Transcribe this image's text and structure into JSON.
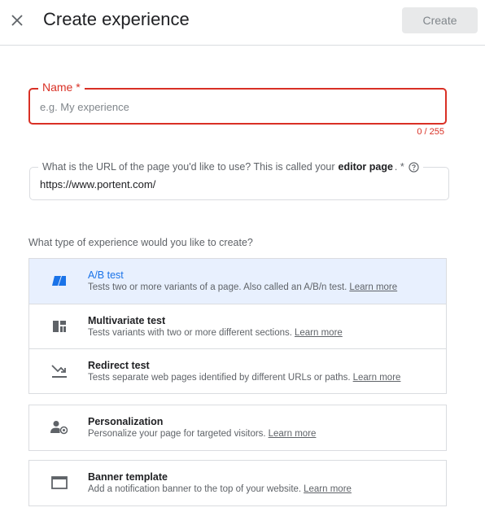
{
  "header": {
    "title": "Create experience",
    "create_label": "Create"
  },
  "name_field": {
    "label": "Name *",
    "placeholder": "e.g. My experience",
    "value": "",
    "counter": "0 / 255"
  },
  "url_field": {
    "label_prefix": "What is the URL of the page you'd like to use? This is called your",
    "label_bold": "editor page",
    "label_suffix": ". *",
    "value": "https://www.portent.com/"
  },
  "experience_type": {
    "question": "What type of experience would you like to create?",
    "options": [
      {
        "title": "A/B test",
        "desc": "Tests two or more variants of a page. Also called an A/B/n test.",
        "link": "Learn more",
        "icon": "ab-test-icon",
        "selected": true
      },
      {
        "title": "Multivariate test",
        "desc": "Tests variants with two or more different sections.",
        "link": "Learn more",
        "icon": "multivariate-icon",
        "selected": false
      },
      {
        "title": "Redirect test",
        "desc": "Tests separate web pages identified by different URLs or paths.",
        "link": "Learn more",
        "icon": "redirect-icon",
        "selected": false
      },
      {
        "title": "Personalization",
        "desc": "Personalize your page for targeted visitors.",
        "link": "Learn more",
        "icon": "personalization-icon",
        "selected": false
      },
      {
        "title": "Banner template",
        "desc": "Add a notification banner to the top of your website.",
        "link": "Learn more",
        "icon": "banner-icon",
        "selected": false
      }
    ]
  },
  "colors": {
    "error": "#d93025",
    "accent": "#1a73e8",
    "selected_bg": "#e8f0fe"
  }
}
